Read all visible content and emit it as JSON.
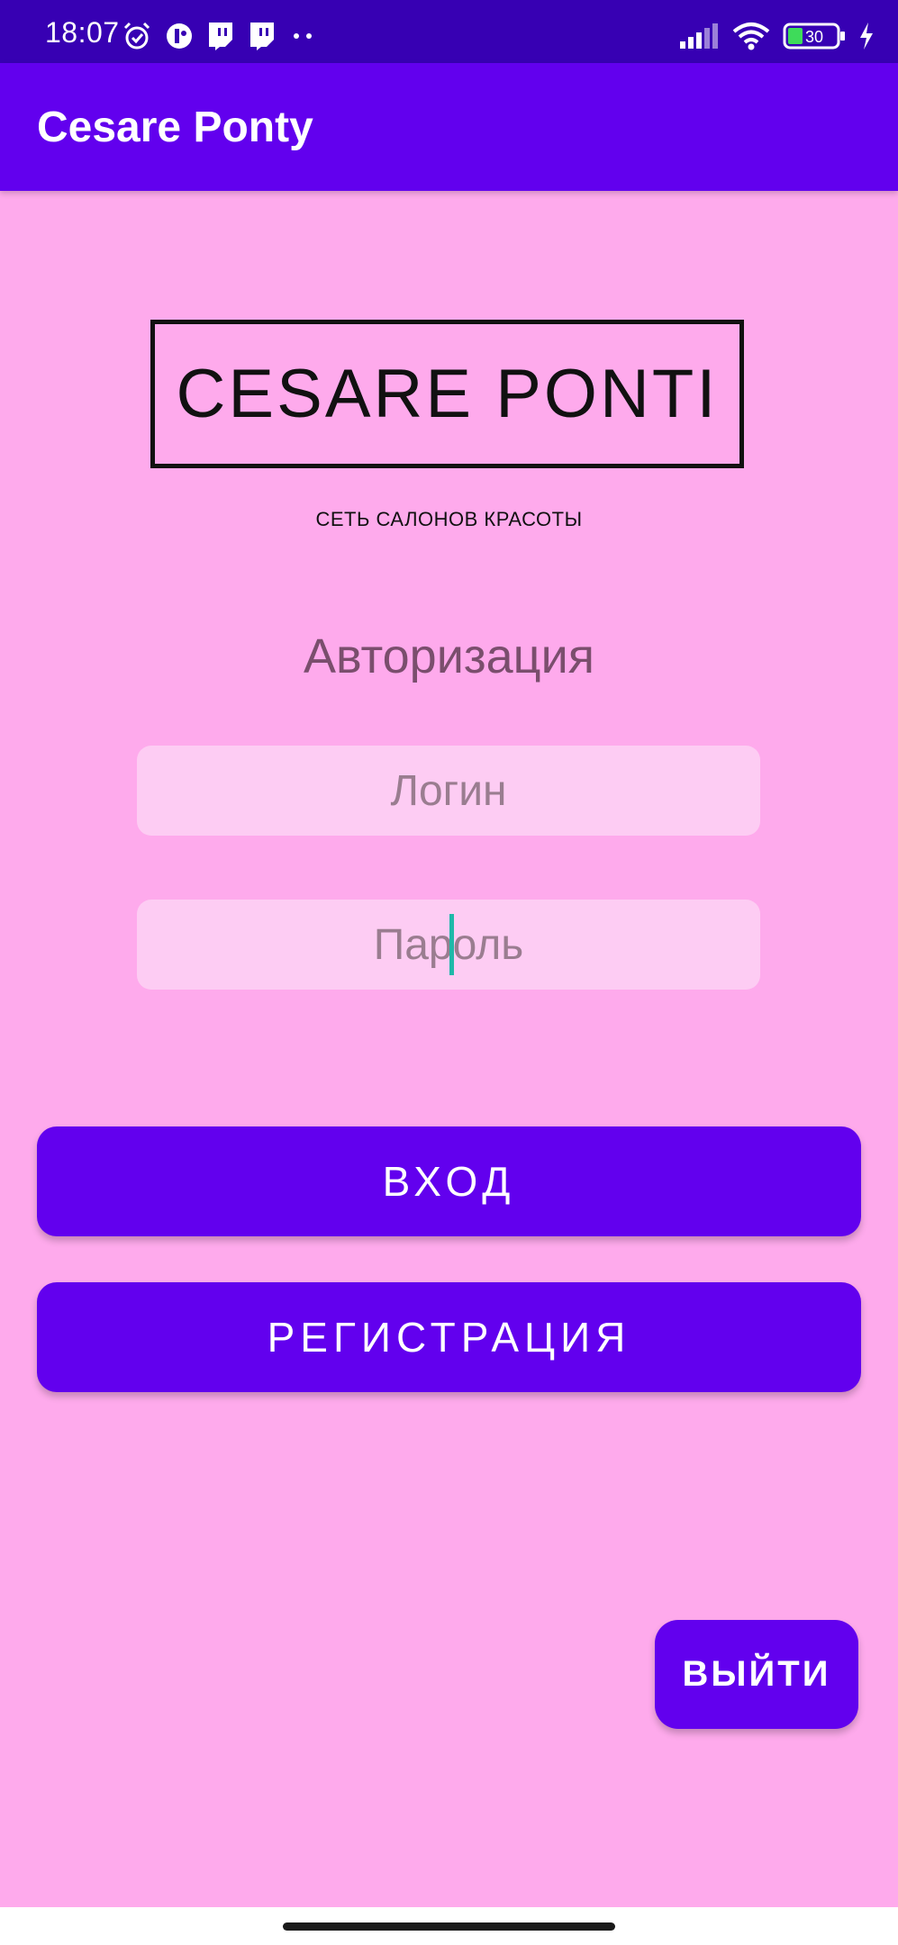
{
  "status_bar": {
    "time": "18:07",
    "battery_level": "30",
    "left_icons": [
      "alarm-icon",
      "app-notification-icon",
      "twitch-icon",
      "twitch-icon",
      "more-dots-icon"
    ],
    "right_icons": [
      "signal-icon",
      "wifi-icon",
      "battery-icon",
      "charging-icon"
    ]
  },
  "app_bar": {
    "title": "Cesare Ponty"
  },
  "logo": {
    "text": "CESARE PONTI",
    "subtitle": "СЕТЬ САЛОНОВ КРАСОТЫ"
  },
  "auth": {
    "title": "Авторизация",
    "login_placeholder": "Логин",
    "password_placeholder": "Пароль"
  },
  "buttons": {
    "login": "ВХОД",
    "register": "РЕГИСТРАЦИЯ",
    "exit": "ВЫЙТИ"
  },
  "colors": {
    "status_bar": "#3700B3",
    "primary": "#6200EE",
    "background": "#FEAAEC",
    "input_background": "#FDCCF3",
    "cursor": "#1FB8A8"
  }
}
